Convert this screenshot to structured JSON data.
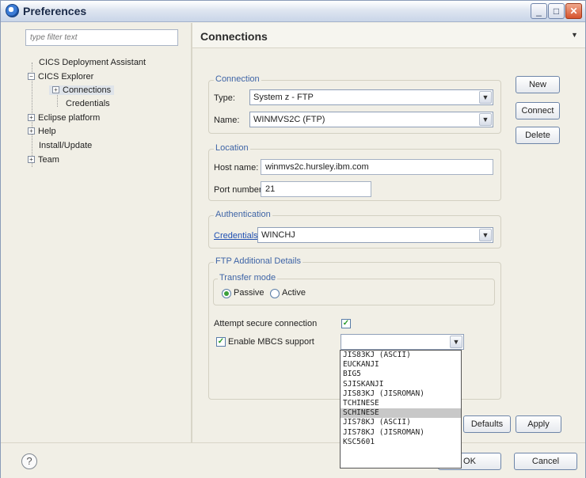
{
  "window": {
    "title": "Preferences"
  },
  "filter": {
    "placeholder": "type filter text"
  },
  "tree": {
    "items": [
      {
        "label": "CICS Deployment Assistant"
      },
      {
        "label": "CICS Explorer",
        "toggle": "⊟"
      },
      {
        "label": "Connections",
        "toggle": "⊞"
      },
      {
        "label": "Credentials"
      },
      {
        "label": "Eclipse platform",
        "toggle": "⊞"
      },
      {
        "label": "Help",
        "toggle": "⊞"
      },
      {
        "label": "Install/Update"
      },
      {
        "label": "Team",
        "toggle": "⊞"
      }
    ]
  },
  "page": {
    "title": "Connections"
  },
  "connection": {
    "group_label": "Connection",
    "type_label": "Type:",
    "type_value": "System z - FTP",
    "name_label": "Name:",
    "name_value": "WINMVS2C (FTP)"
  },
  "actions": {
    "new": "New",
    "connect": "Connect",
    "delete": "Delete"
  },
  "location": {
    "group_label": "Location",
    "host_label": "Host name:",
    "host_value": "winmvs2c.hursley.ibm.com",
    "port_label": "Port number:",
    "port_value": "21"
  },
  "authentication": {
    "group_label": "Authentication",
    "credentials_label": "Credentials:",
    "credentials_value": "WINCHJ"
  },
  "ftp": {
    "group_label": "FTP Additional Details",
    "transfer_label": "Transfer mode",
    "passive_label": "Passive",
    "active_label": "Active",
    "secure_label": "Attempt secure connection",
    "mbcs_label": "Enable MBCS support",
    "mbcs_value": ""
  },
  "dropdown": {
    "options": [
      "JIS83KJ (ASCII)",
      "EUCKANJI",
      "BIG5",
      "SJISKANJI",
      "JIS83KJ (JISROMAN)",
      "TCHINESE",
      "SCHINESE",
      "JIS78KJ (ASCII)",
      "JIS78KJ (JISROMAN)",
      "KSC5601"
    ],
    "highlighted": "SCHINESE"
  },
  "page_buttons": {
    "defaults": "Defaults",
    "apply": "Apply"
  },
  "dialog_buttons": {
    "ok": "OK",
    "cancel": "Cancel"
  },
  "icons": {
    "help": "?"
  }
}
